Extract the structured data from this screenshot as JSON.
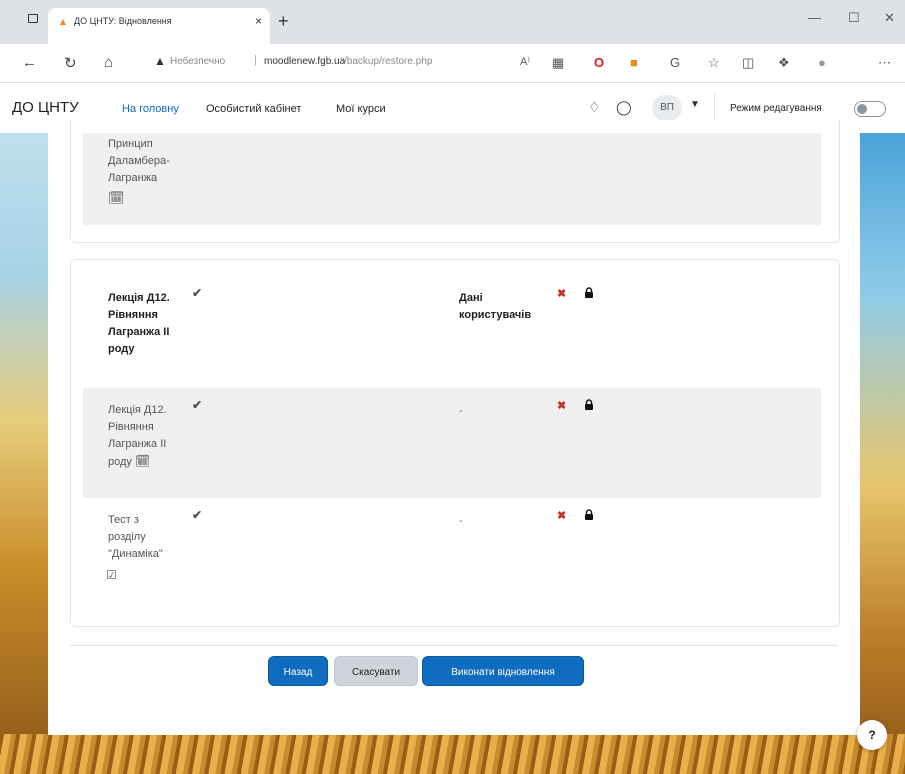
{
  "browser": {
    "tab_title": "ДО ЦНТУ: Відновлення",
    "tab_close": "×",
    "new_tab": "+",
    "url_insecure": "Небезпечно",
    "url_separator": "|",
    "url_host": "moodlenew.fgb.ua",
    "url_path": "/backup/restore.php"
  },
  "navbar": {
    "brand": "ДО ЦНТУ",
    "links": [
      "На головну",
      "Особистий кабінет",
      "Мої курси"
    ],
    "avatar_initials": "ВП",
    "edit_mode_label": "Режим редагування"
  },
  "top_item": {
    "label_lines": [
      "Принцип",
      "Даламбера-",
      "Лагранжа"
    ]
  },
  "section": {
    "title_lines": [
      "Лекція Д12.",
      "Рівняння",
      "Лагранжа II",
      "роду"
    ],
    "column_header_lines": [
      "Дані",
      "користувачів"
    ]
  },
  "rows": [
    {
      "label_lines": [
        "Лекція Д12.",
        "Рівняння",
        "Лагранжа II",
        "роду"
      ],
      "user_data": "-"
    },
    {
      "label_lines": [
        "Тест з",
        "розділу",
        "\"Динаміка\""
      ],
      "user_data": "-"
    }
  ],
  "buttons": {
    "back": "Назад",
    "cancel": "Скасувати",
    "perform_restore": "Виконати відновлення"
  },
  "help_label": "?"
}
